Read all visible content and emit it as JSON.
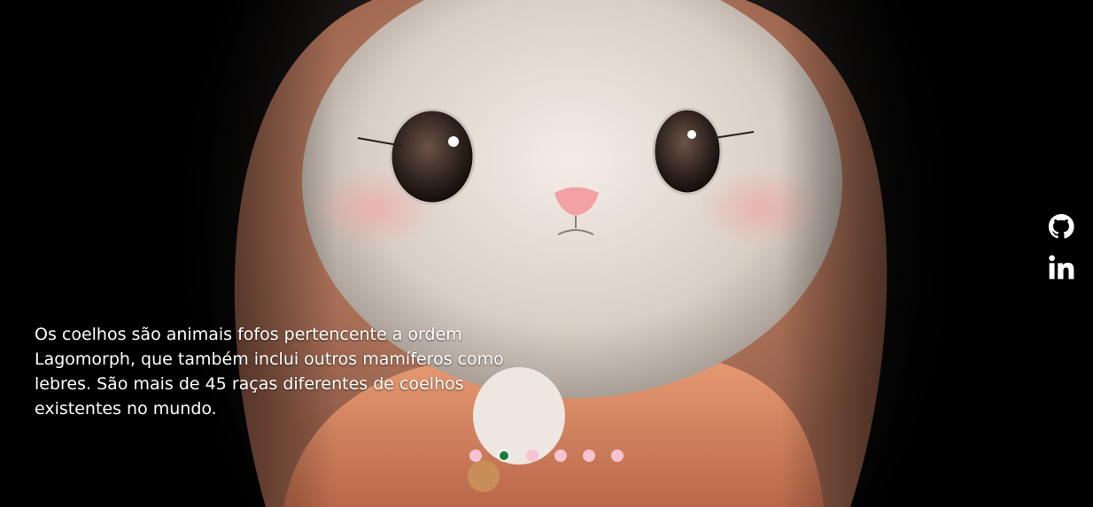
{
  "hero": {
    "image": "bunny-in-orange-hood",
    "caption": "Os coelhos são animais fofos pertencente a ordem Lagomorph, que também inclui outros mamíferos como lebres. São mais de 45 raças diferentes de coelhos existentes no mundo."
  },
  "socials": [
    {
      "icon": "github-icon"
    },
    {
      "icon": "linkedin-icon"
    }
  ],
  "carousel": {
    "slide_count": 6,
    "active_index": 1,
    "colors": {
      "dot": "#f6c3d2",
      "active": "#1f7a3c"
    }
  }
}
